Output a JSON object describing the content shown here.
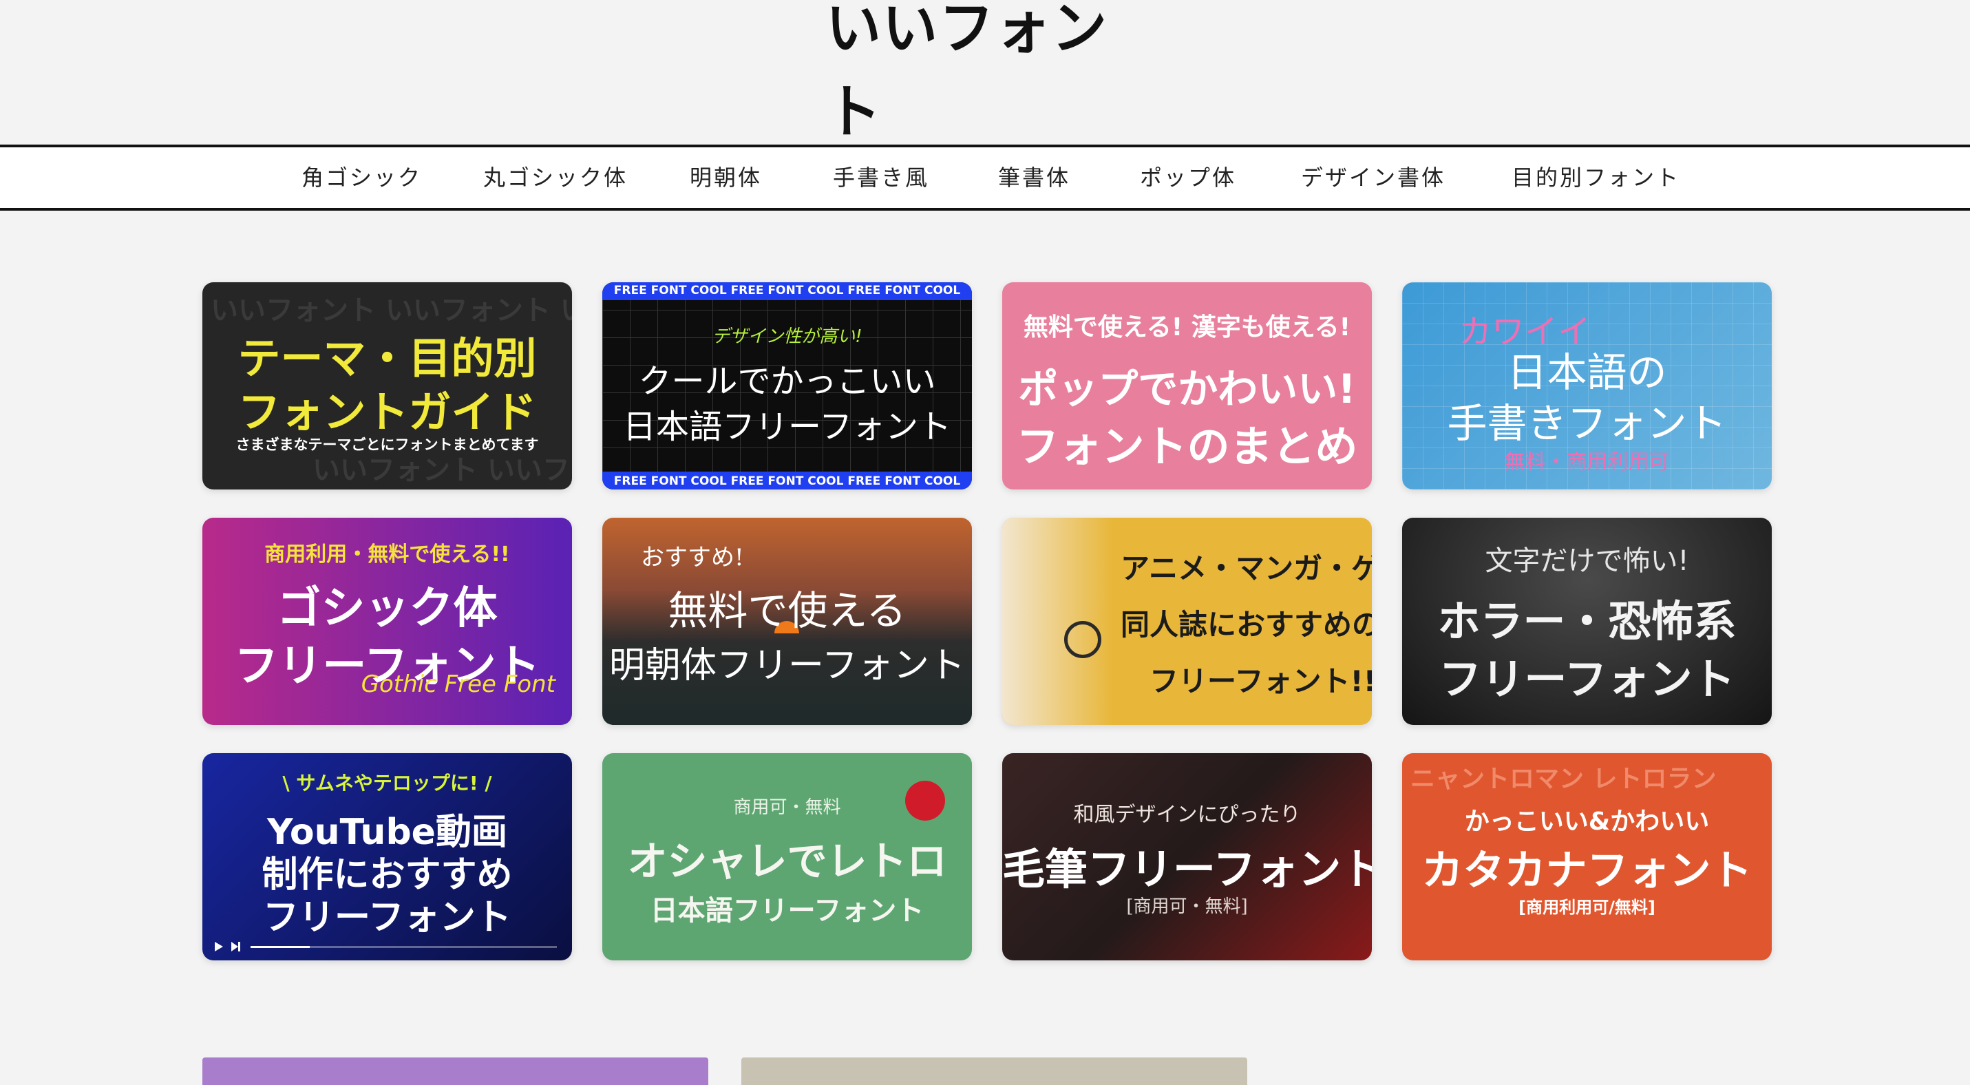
{
  "site": {
    "logo": "いいフォント"
  },
  "nav": [
    {
      "label": "角ゴシック"
    },
    {
      "label": "丸ゴシック体"
    },
    {
      "label": "明朝体"
    },
    {
      "label": "手書き風"
    },
    {
      "label": "筆書体"
    },
    {
      "label": "ポップ体"
    },
    {
      "label": "デザイン書体"
    },
    {
      "label": "目的別フォント"
    }
  ],
  "cards": [
    {
      "bg": "#262626",
      "line1": "テーマ・目的別",
      "line2": "フォントガイド",
      "sub": "さまざまなテーマごとにフォントまとめてます",
      "bgtext": "いいフォント いいフォント いいフォント"
    },
    {
      "bg": "#0d0d0d",
      "accent": "#1f3ff0",
      "marquee": "FREE FONT COOL FREE FONT COOL FREE FONT COOL",
      "tag": "デザイン性が高い!",
      "line1": "クールでかっこいい",
      "line2": "日本語フリーフォント"
    },
    {
      "bg": "#e8809d",
      "tag": "無料で使える! 漢字も使える!",
      "line1": "ポップでかわいい!",
      "line2": "フォントのまとめ"
    },
    {
      "bg": "#3d9ad6",
      "tag": "カワイイ",
      "line1": "日本語の",
      "line2": "手書きフォント",
      "sub": "無料・商用利用可"
    },
    {
      "bg": "#7a1fa0",
      "tag": "商用利用・無料で使える!!",
      "line1": "ゴシック体",
      "line2": "フリーフォント",
      "sub": "Gothic Free Font"
    },
    {
      "bg": "#5a4032",
      "tag": "おすすめ!",
      "line1": "無料で使える",
      "line2": "明朝体フリーフォント"
    },
    {
      "bg": "#e8b73a",
      "line1": "アニメ・マンガ・ゲーム",
      "line2": "同人誌におすすめの",
      "line3": "フリーフォント!!"
    },
    {
      "bg": "#2a2a2a",
      "tag": "文字だけで怖い!",
      "line1": "ホラー・恐怖系",
      "line2": "フリーフォント"
    },
    {
      "bg": "#141a6e",
      "tag": "\\ サムネやテロップに! /",
      "line1": "YouTube動画",
      "line2": "制作におすすめ",
      "line3": "フリーフォント"
    },
    {
      "bg": "#5da672",
      "tag": "商用可・無料",
      "line1": "オシャレでレトロ",
      "line2": "日本語フリーフォント"
    },
    {
      "bg": "#2b1c1c",
      "tag": "和風デザインにぴったり",
      "line1": "毛筆フリーフォント",
      "sub": "[商用可・無料]"
    },
    {
      "bg": "#e0572f",
      "tag": "かっこいい&かわいい",
      "line1": "カタカナフォント",
      "sub": "[商用利用可/無料]",
      "bgtext": "ニャントロマン レトロラン"
    }
  ],
  "bottom_tiles": [
    {
      "color": "#a87dcc"
    },
    {
      "color": "#c8c2b2"
    }
  ]
}
